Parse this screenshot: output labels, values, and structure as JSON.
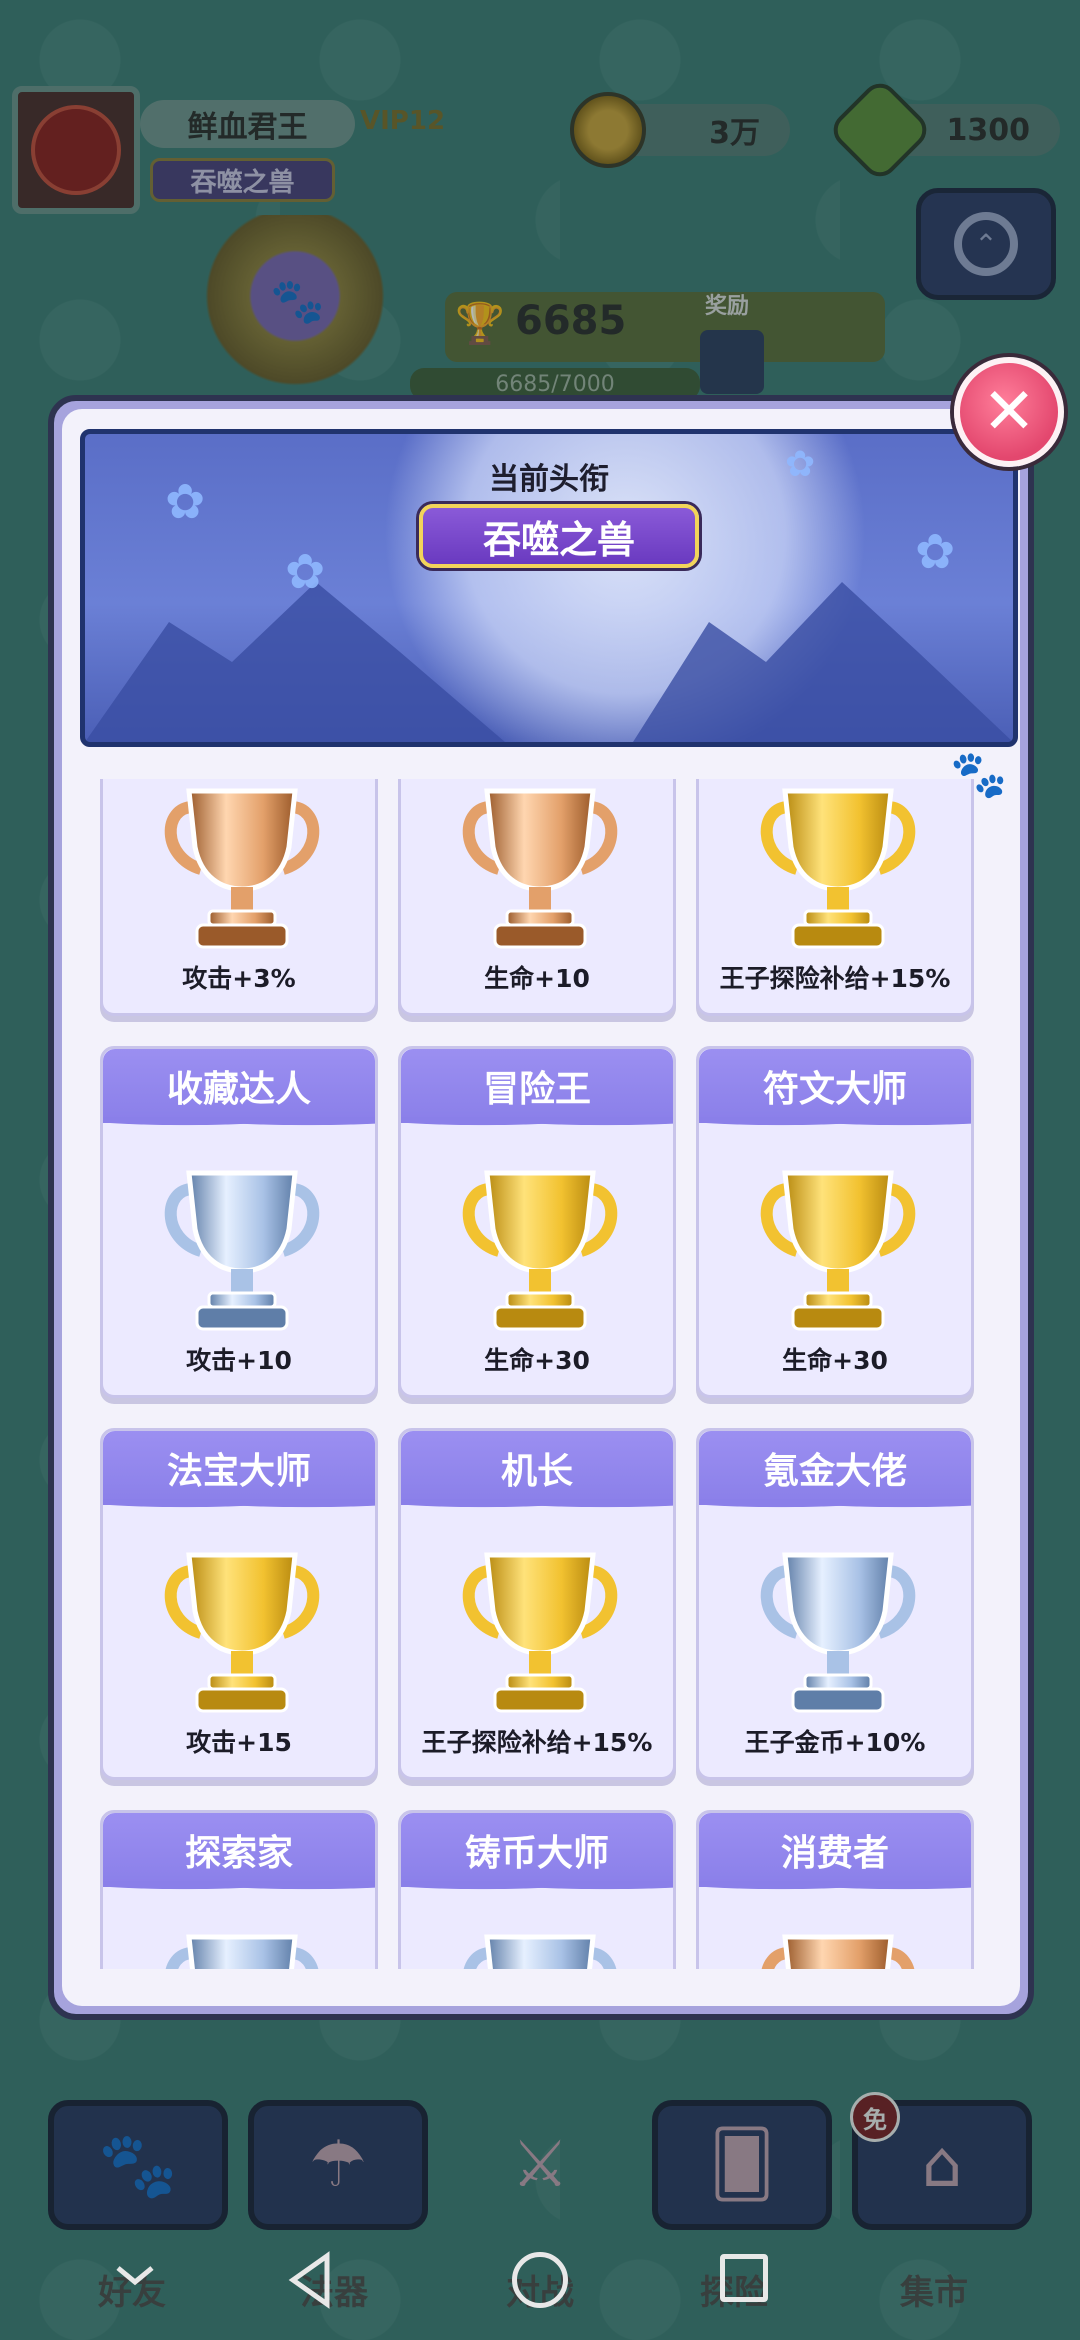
{
  "player": {
    "name": "鲜血君王",
    "vip": "VIP12",
    "title": "吞噬之兽"
  },
  "currency": {
    "coins": "3万",
    "gems": "1300"
  },
  "trophy_progress": {
    "score": "6685",
    "progress_text": "6685/7000",
    "progress_fraction": 0.955,
    "reward_label": "奖励"
  },
  "modal": {
    "current_title_label": "当前头衔",
    "current_title": "吞噬之兽",
    "close_icon": "close-icon",
    "rows": [
      [
        {
          "name": "",
          "bonus": "攻击+3%",
          "cup": "bronze"
        },
        {
          "name": "",
          "bonus": "生命+10",
          "cup": "bronze"
        },
        {
          "name": "",
          "bonus": "王子探险补给+15%",
          "cup": "gold"
        }
      ],
      [
        {
          "name": "收藏达人",
          "bonus": "攻击+10",
          "cup": "silver"
        },
        {
          "name": "冒险王",
          "bonus": "生命+30",
          "cup": "gold"
        },
        {
          "name": "符文大师",
          "bonus": "生命+30",
          "cup": "gold"
        }
      ],
      [
        {
          "name": "法宝大师",
          "bonus": "攻击+15",
          "cup": "gold"
        },
        {
          "name": "机长",
          "bonus": "王子探险补给+15%",
          "cup": "gold"
        },
        {
          "name": "氪金大佬",
          "bonus": "王子金币+10%",
          "cup": "silver"
        }
      ],
      [
        {
          "name": "探索家",
          "bonus": "",
          "cup": "silver"
        },
        {
          "name": "铸币大师",
          "bonus": "",
          "cup": "silver"
        },
        {
          "name": "消费者",
          "bonus": "",
          "cup": "bronze"
        }
      ]
    ]
  },
  "bottom_nav": {
    "labels": [
      "好友",
      "法器",
      "对战",
      "探险",
      "集市"
    ],
    "free_badge": "免"
  },
  "colors": {
    "gold": "#f2c230",
    "silver": "#a9c2e6",
    "bronze": "#e3a06a",
    "card_header": "#8a7fe9",
    "close_button": "#e3476e"
  }
}
